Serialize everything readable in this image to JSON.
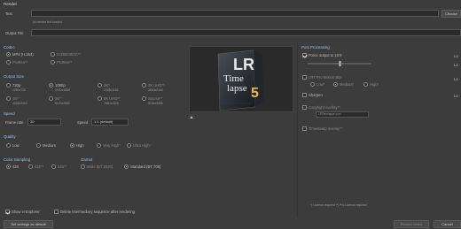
{
  "render": {
    "title": "Render"
  },
  "text": {
    "label": "Text",
    "hint": "No render text loaded",
    "choose": "Choose"
  },
  "output": {
    "label": "Output File"
  },
  "codec": {
    "title": "Codec",
    "options": [
      {
        "label": "MP4 (H.264)",
        "selected": true
      },
      {
        "label": "H.265/HEVC**",
        "selected": false
      },
      {
        "label": "ProRes**",
        "selected": false
      },
      {
        "label": "ProRes**",
        "selected": false
      }
    ]
  },
  "output_size": {
    "title": "Output Size",
    "options": [
      {
        "label": "720p",
        "sub": "1280x720",
        "selected": false
      },
      {
        "label": "1080p",
        "sub": "1920x1080",
        "selected": true
      },
      {
        "label": "2K*",
        "sub": "2048x1152",
        "selected": false
      },
      {
        "label": "4K UHD**",
        "sub": "3840x2160",
        "selected": false
      },
      {
        "label": "4K*",
        "sub": "4096x2304",
        "selected": false
      },
      {
        "label": "5K*",
        "sub": "5120x2880",
        "selected": false
      },
      {
        "label": "8K UHD**",
        "sub": "7680x4320",
        "selected": false
      },
      {
        "label": "Source**",
        "sub": "5184x3456",
        "selected": false
      }
    ]
  },
  "speed": {
    "title": "Speed",
    "frame_rate_label": "Frame rate",
    "frame_rate_value": "30",
    "speed_label": "Speed",
    "speed_value": "1:1 (default)"
  },
  "quality": {
    "title": "Quality",
    "options": [
      {
        "label": "Low",
        "selected": false
      },
      {
        "label": "Medium",
        "selected": false
      },
      {
        "label": "High",
        "selected": true
      },
      {
        "label": "Very High*",
        "selected": false
      },
      {
        "label": "Ultra High*",
        "selected": false
      }
    ]
  },
  "color_sampling": {
    "title": "Color Sampling",
    "options": [
      {
        "label": "420",
        "selected": true
      },
      {
        "label": "422**",
        "selected": false
      },
      {
        "label": "444**",
        "selected": false
      }
    ]
  },
  "gamut": {
    "title": "Gamut",
    "options": [
      {
        "label": "Wide (BT 2020)",
        "selected": false
      },
      {
        "label": "Standard (BT 709)",
        "selected": true
      }
    ]
  },
  "bottom": {
    "show_in_explorer": "Show in Explorer",
    "delete_intermediary": "Delete intermediary sequence after rendering",
    "set_default": "Set settings as default",
    "render_video": "Render Video",
    "cancel": "Cancel"
  },
  "post_processing": {
    "title": "Post Processing",
    "force_output": "Force output to 16:9",
    "lrt_motion_blur": "LRT Pro Motion Blur",
    "blur_low": "Low*",
    "blur_medium": "Medium*",
    "blur_high": "High*",
    "sharpen": "Sharpen",
    "copyright": "Copyright overlay**",
    "copyright_value": "LRTimelapse.com",
    "timestamp": "Timestamp overlay**",
    "right_labels": [
      "Lo",
      "Lo",
      "Lo",
      "Lo"
    ],
    "license_note": "*) License required  **) Pro License required"
  },
  "preview": {
    "logo_top": "LR",
    "logo_mid": "Time",
    "logo_bot": "lapse",
    "logo_num": "5"
  },
  "colors": {
    "accent_blue": "#9ec0e8",
    "bg": "#3c3c3c",
    "field": "#2b2b2b"
  }
}
